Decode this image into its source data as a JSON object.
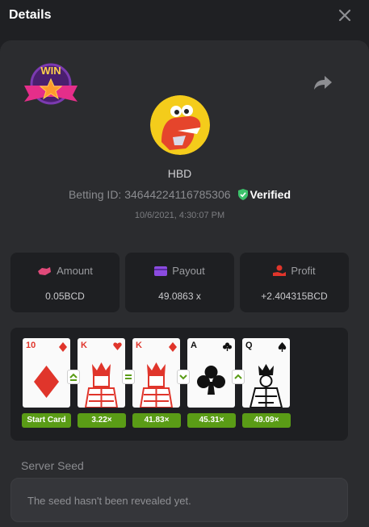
{
  "header": {
    "title": "Details"
  },
  "user": {
    "name": "HBD",
    "betting_id_label": "Betting ID: 34644224116785306",
    "verified_label": "Verified",
    "datetime": "10/6/2021, 4:30:07 PM"
  },
  "badge": {
    "text": "WIN"
  },
  "stats": {
    "amount": {
      "label": "Amount",
      "value": "0.05BCD"
    },
    "payout": {
      "label": "Payout",
      "value": "49.0863 x"
    },
    "profit": {
      "label": "Profit",
      "value": "+2.404315BCD"
    }
  },
  "cards": [
    {
      "rank": "10",
      "suit": "diamond",
      "color": "#e0352b",
      "multiplier": "Start Card"
    },
    {
      "rank": "K",
      "suit": "heart",
      "color": "#e0352b",
      "multiplier": "3.22×"
    },
    {
      "rank": "K",
      "suit": "diamond",
      "color": "#e0352b",
      "multiplier": "41.83×"
    },
    {
      "rank": "A",
      "suit": "club",
      "color": "#111111",
      "multiplier": "45.31×"
    },
    {
      "rank": "Q",
      "suit": "spade",
      "color": "#111111",
      "multiplier": "49.09×"
    }
  ],
  "guesses": [
    "higher",
    "equal",
    "lower",
    "higher"
  ],
  "server_seed": {
    "label": "Server Seed",
    "text": "The seed hasn't been revealed yet."
  },
  "colors": {
    "accent_green": "#5a9c16",
    "verified_green": "#3cc26b",
    "card_red": "#e0352b"
  },
  "icons": [
    "close-icon",
    "share-icon",
    "verified-shield-icon",
    "amount-icon",
    "payout-icon",
    "profit-icon"
  ]
}
